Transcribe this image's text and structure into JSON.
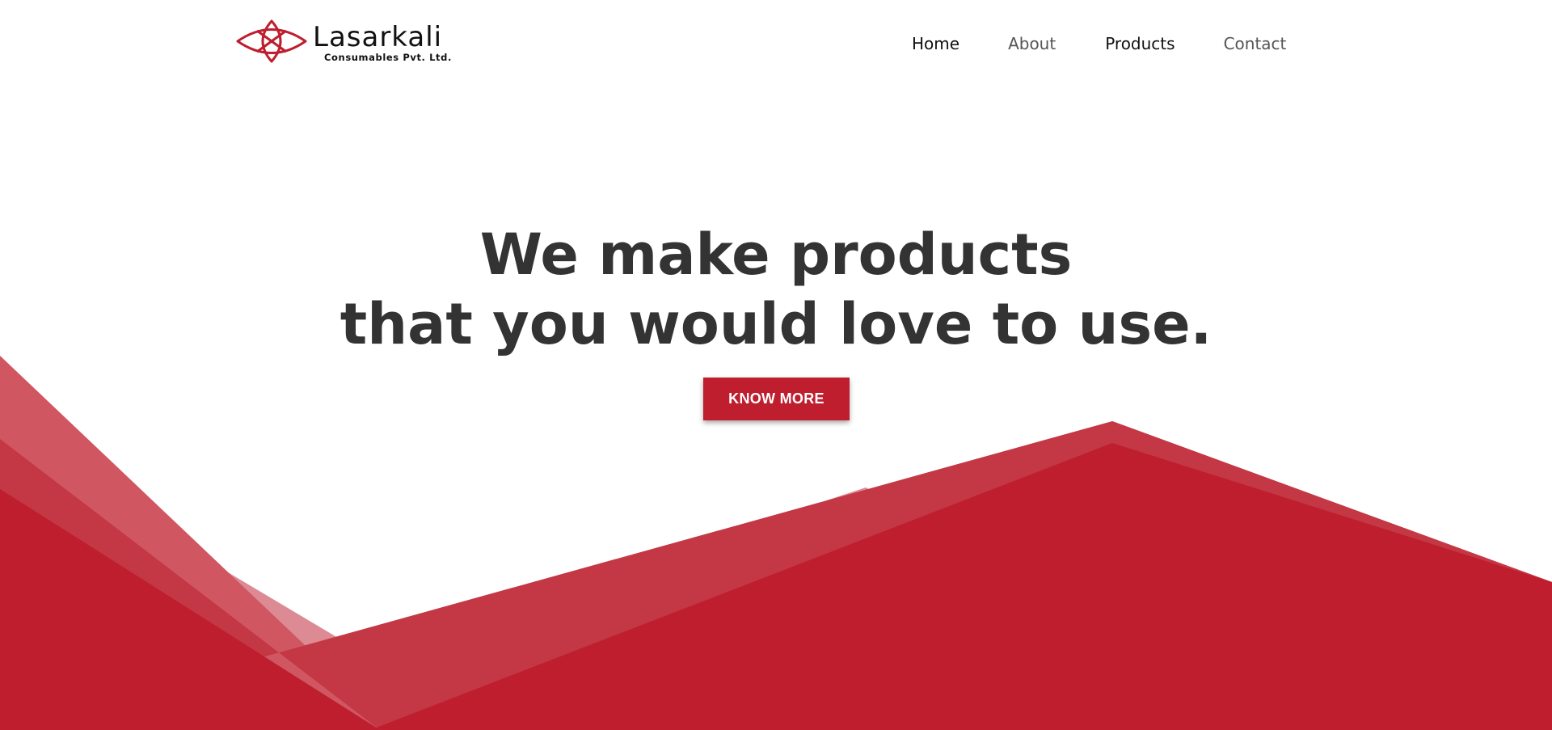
{
  "brand": {
    "name": "Lasarkali",
    "tagline": "Consumables Pvt. Ltd.",
    "logo_icon": "lotus-icon",
    "color": "#be1e2d"
  },
  "nav": {
    "items": [
      {
        "label": "Home"
      },
      {
        "label": "About"
      },
      {
        "label": "Products"
      },
      {
        "label": "Contact"
      }
    ]
  },
  "hero": {
    "title_line1": "We make products",
    "title_line2": "that you would love to use.",
    "cta_label": "KNOW MORE"
  },
  "colors": {
    "accent": "#be1e2d",
    "heading": "#333333",
    "background": "#ffffff"
  }
}
